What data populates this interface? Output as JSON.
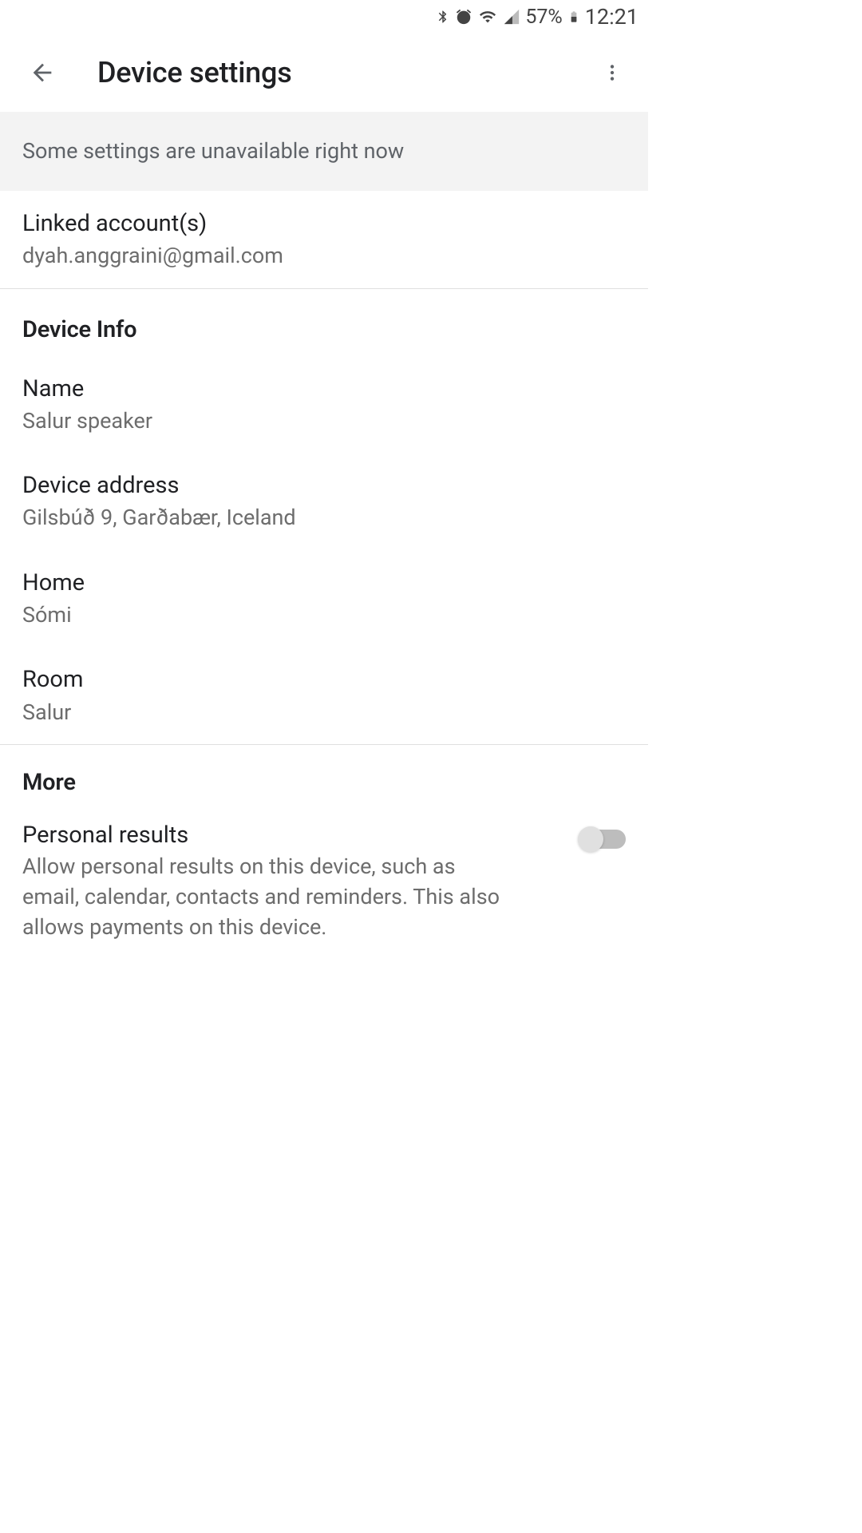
{
  "status_bar": {
    "battery_pct": "57%",
    "time": "12:21"
  },
  "header": {
    "title": "Device settings"
  },
  "banner": {
    "message": "Some settings are unavailable right now"
  },
  "linked_accounts": {
    "label": "Linked account(s)",
    "value": "dyah.anggraini@gmail.com"
  },
  "device_info": {
    "header": "Device Info",
    "items": [
      {
        "label": "Name",
        "value": "Salur speaker"
      },
      {
        "label": "Device address",
        "value": "Gilsbúð 9, Garðabær, Iceland"
      },
      {
        "label": "Home",
        "value": "Sómi"
      },
      {
        "label": "Room",
        "value": "Salur"
      }
    ]
  },
  "more": {
    "header": "More",
    "personal_results": {
      "label": "Personal results",
      "description": "Allow personal results on this device, such as email, calendar, contacts and reminders. This also allows payments on this device.",
      "enabled": false
    }
  }
}
